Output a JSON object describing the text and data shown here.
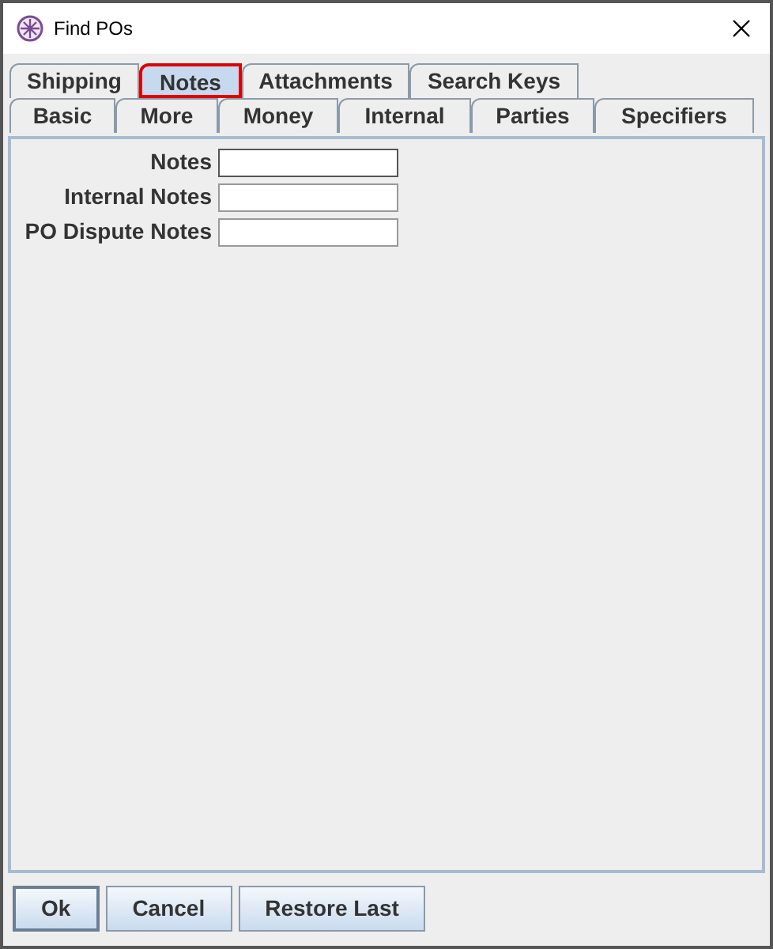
{
  "window": {
    "title": "Find POs"
  },
  "tab_rows": [
    [
      {
        "label": "Shipping",
        "selected": false
      },
      {
        "label": "Notes",
        "selected": true
      },
      {
        "label": "Attachments",
        "selected": false
      },
      {
        "label": "Search Keys",
        "selected": false
      }
    ],
    [
      {
        "label": "Basic",
        "selected": false
      },
      {
        "label": "More",
        "selected": false
      },
      {
        "label": "Money",
        "selected": false
      },
      {
        "label": "Internal",
        "selected": false
      },
      {
        "label": "Parties",
        "selected": false
      },
      {
        "label": "Specifiers",
        "selected": false
      }
    ]
  ],
  "fields": [
    {
      "label": "Notes",
      "focused": true
    },
    {
      "label": "Internal Notes",
      "focused": false
    },
    {
      "label": "PO Dispute Notes",
      "focused": false
    }
  ],
  "buttons": [
    {
      "label": "Ok",
      "default": true
    },
    {
      "label": "Cancel",
      "default": false
    },
    {
      "label": "Restore Last",
      "default": false
    }
  ]
}
